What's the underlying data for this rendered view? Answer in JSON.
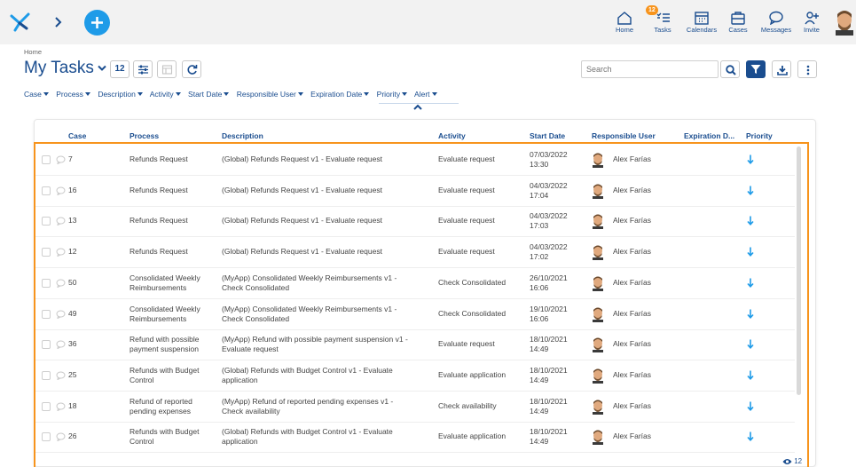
{
  "topnav": {
    "items": [
      {
        "label": "Home",
        "icon": "home-icon"
      },
      {
        "label": "Tasks",
        "icon": "tasks-icon",
        "badge": "12"
      },
      {
        "label": "Calendars",
        "icon": "calendar-icon"
      },
      {
        "label": "Cases",
        "icon": "cases-icon"
      },
      {
        "label": "Messages",
        "icon": "messages-icon"
      },
      {
        "label": "Invite",
        "icon": "invite-icon"
      }
    ]
  },
  "breadcrumb": "Home",
  "page": {
    "title": "My Tasks",
    "count": "12"
  },
  "search": {
    "placeholder": "Search"
  },
  "filters": [
    "Case",
    "Process",
    "Description",
    "Activity",
    "Start Date",
    "Responsible User",
    "Expiration Date",
    "Priority",
    "Alert"
  ],
  "table": {
    "headers": [
      "Case",
      "Process",
      "Description",
      "Activity",
      "Start Date",
      "Responsible User",
      "Expiration D...",
      "Priority"
    ],
    "rows": [
      {
        "case": "7",
        "process": [
          "Refunds Request"
        ],
        "description": [
          "(Global) Refunds Request v1 - Evaluate request"
        ],
        "activity": "Evaluate request",
        "date": "07/03/2022",
        "time": "13:30",
        "user": "Alex Farías"
      },
      {
        "case": "16",
        "process": [
          "Refunds Request"
        ],
        "description": [
          "(Global) Refunds Request v1 - Evaluate request"
        ],
        "activity": "Evaluate request",
        "date": "04/03/2022",
        "time": "17:04",
        "user": "Alex Farías"
      },
      {
        "case": "13",
        "process": [
          "Refunds Request"
        ],
        "description": [
          "(Global) Refunds Request v1 - Evaluate request"
        ],
        "activity": "Evaluate request",
        "date": "04/03/2022",
        "time": "17:03",
        "user": "Alex Farías"
      },
      {
        "case": "12",
        "process": [
          "Refunds Request"
        ],
        "description": [
          "(Global) Refunds Request v1 - Evaluate request"
        ],
        "activity": "Evaluate request",
        "date": "04/03/2022",
        "time": "17:02",
        "user": "Alex Farías"
      },
      {
        "case": "50",
        "process": [
          "Consolidated Weekly",
          "Reimbursements"
        ],
        "description": [
          "(MyApp) Consolidated Weekly Reimbursements v1 -",
          "Check Consolidated"
        ],
        "activity": "Check Consolidated",
        "date": "26/10/2021",
        "time": "16:06",
        "user": "Alex Farías"
      },
      {
        "case": "49",
        "process": [
          "Consolidated Weekly",
          "Reimbursements"
        ],
        "description": [
          "(MyApp) Consolidated Weekly Reimbursements v1 -",
          "Check Consolidated"
        ],
        "activity": "Check Consolidated",
        "date": "19/10/2021",
        "time": "16:06",
        "user": "Alex Farías"
      },
      {
        "case": "36",
        "process": [
          "Refund with possible",
          "payment suspension"
        ],
        "description": [
          "(MyApp) Refund with possible payment suspension v1 -",
          "Evaluate request"
        ],
        "activity": "Evaluate request",
        "date": "18/10/2021",
        "time": "14:49",
        "user": "Alex Farías"
      },
      {
        "case": "25",
        "process": [
          "Refunds with Budget",
          "Control"
        ],
        "description": [
          "(Global) Refunds with Budget Control v1 - Evaluate",
          "application"
        ],
        "activity": "Evaluate application",
        "date": "18/10/2021",
        "time": "14:49",
        "user": "Alex Farías"
      },
      {
        "case": "18",
        "process": [
          "Refund of reported",
          "pending expenses"
        ],
        "description": [
          "(MyApp) Refund of reported pending expenses v1 -",
          "Check availability"
        ],
        "activity": "Check availability",
        "date": "18/10/2021",
        "time": "14:49",
        "user": "Alex Farías"
      },
      {
        "case": "26",
        "process": [
          "Refunds with Budget",
          "Control"
        ],
        "description": [
          "(Global) Refunds with Budget Control v1 - Evaluate",
          "application"
        ],
        "activity": "Evaluate application",
        "date": "18/10/2021",
        "time": "14:49",
        "user": "Alex Farías"
      }
    ]
  },
  "footer": {
    "view_count": "12"
  },
  "colors": {
    "primary": "#1a4d8f",
    "accent": "#1e9be8",
    "selection": "#f7941d"
  }
}
